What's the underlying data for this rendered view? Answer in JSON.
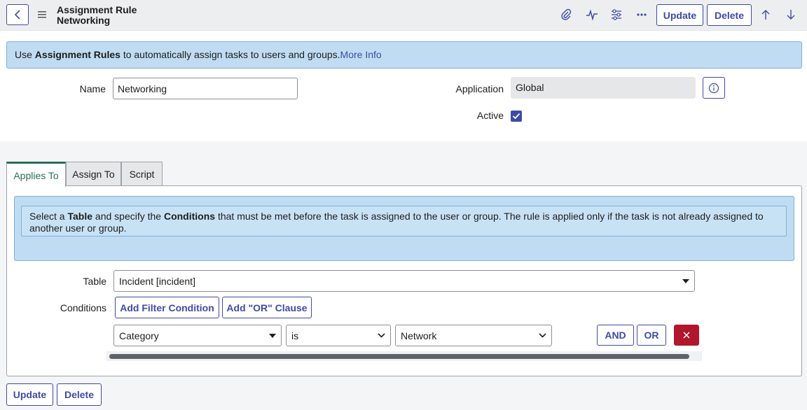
{
  "header": {
    "title_line1": "Assignment Rule",
    "title_line2": "Networking",
    "update_label": "Update",
    "delete_label": "Delete"
  },
  "banner": {
    "prefix": "Use ",
    "bold": "Assignment Rules",
    "suffix": " to automatically assign tasks to users and groups.",
    "link": "More Info"
  },
  "form": {
    "name_label": "Name",
    "name_value": "Networking",
    "application_label": "Application",
    "application_value": "Global",
    "active_label": "Active",
    "active_checked": true
  },
  "tabs": [
    {
      "label": "Applies To",
      "active": true
    },
    {
      "label": "Assign To",
      "active": false
    },
    {
      "label": "Script",
      "active": false
    }
  ],
  "applies_to": {
    "info_prefix": "Select a ",
    "info_bold1": "Table",
    "info_mid": " and specify the ",
    "info_bold2": "Conditions",
    "info_suffix": " that must be met before the task is assigned to the user or group. The rule is applied only if the task is not already assigned to another user or group.",
    "table_label": "Table",
    "table_value": "Incident [incident]",
    "conditions_label": "Conditions",
    "add_filter_label": "Add Filter Condition",
    "add_or_label": "Add \"OR\" Clause",
    "condition": {
      "field": "Category",
      "operator": "is",
      "value": "Network"
    },
    "and_label": "AND",
    "or_label": "OR"
  },
  "footer": {
    "update_label": "Update",
    "delete_label": "Delete"
  },
  "colors": {
    "accent": "#3f4aa8",
    "banner_bg": "#bfdcf2",
    "active_tab": "#2b6e55",
    "danger": "#b0162c"
  }
}
